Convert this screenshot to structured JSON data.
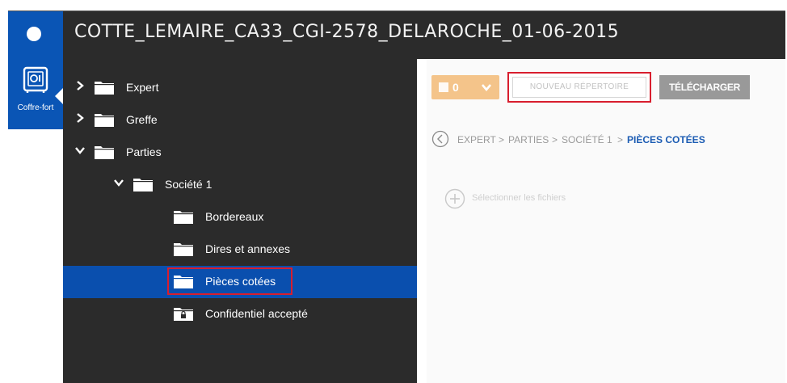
{
  "header": {
    "title": "COTTE_LEMAIRE_CA33_CGI-2578_DELAROCHE_01-06-2015"
  },
  "rail": {
    "items": [
      {
        "label": "Coffre-fort",
        "icon": "safe-icon"
      }
    ]
  },
  "tree": {
    "nodes": [
      {
        "label": "Expert",
        "expanded": false
      },
      {
        "label": "Greffe",
        "expanded": false
      },
      {
        "label": "Parties",
        "expanded": true
      },
      {
        "label": "Société 1",
        "expanded": true
      },
      {
        "label": "Bordereaux"
      },
      {
        "label": "Dires et annexes"
      },
      {
        "label": "Pièces cotées",
        "selected": true
      },
      {
        "label": "Confidentiel accepté",
        "locked": true
      }
    ]
  },
  "toolbar": {
    "count": "0",
    "new_folder_label": "NOUVEAU RÉPERTOIRE",
    "download_label": "TÉLÉCHARGER"
  },
  "breadcrumb": {
    "items": [
      "EXPERT",
      "PARTIES",
      "SOCIÉTÉ 1",
      "PIÈCES COTÉES"
    ],
    "separator": ">"
  },
  "upload": {
    "label": "Sélectionner les fichiers"
  },
  "colors": {
    "accent_blue": "#0a55b5",
    "dark_panel": "#2b2b2b",
    "highlight_red": "#d81e2e",
    "orange": "#f4c48a",
    "gray_button": "#999999"
  }
}
